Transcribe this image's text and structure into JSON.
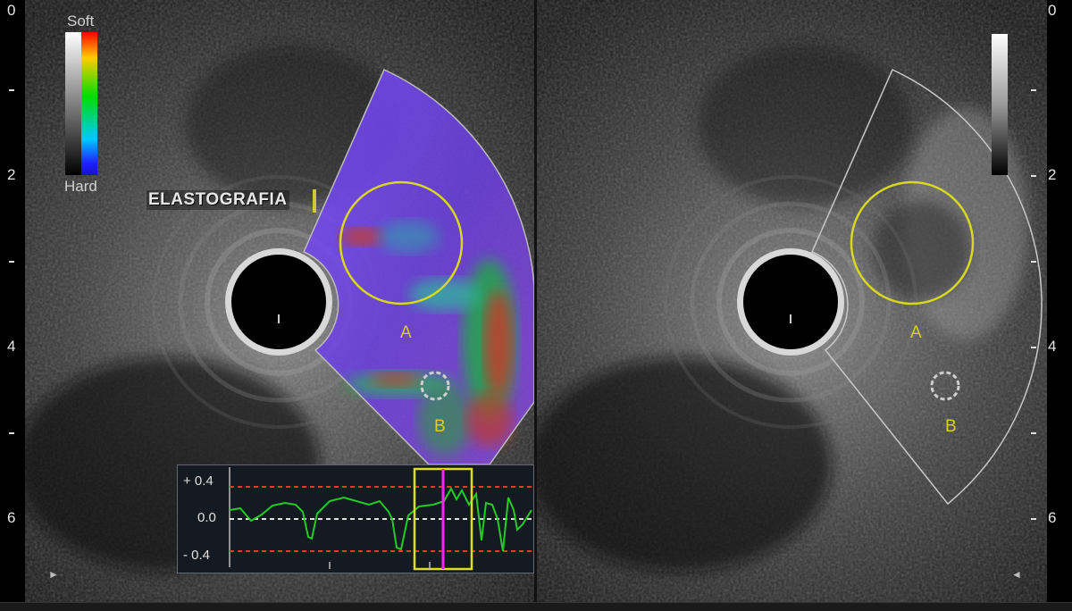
{
  "left_image": {
    "legend": {
      "top_label": "Soft",
      "bottom_label": "Hard"
    },
    "overlay_label": "ELASTOGRAFIA",
    "roi_labels": [
      "A",
      "B"
    ]
  },
  "right_image": {
    "roi_labels": [
      "A",
      "B"
    ]
  },
  "depth_scale": {
    "labels": [
      "0",
      "2",
      "4",
      "6"
    ]
  },
  "strain_graph": {
    "y_labels": [
      "+ 0.4",
      "0.0",
      "- 0.4"
    ],
    "colors": {
      "trace": "#22cc22",
      "limit": "#ff3333",
      "window": "#dddd22",
      "marker": "#ff22ff"
    }
  },
  "colors": {
    "roi_circle": "#d8d820",
    "roi_label": "#d8d020"
  }
}
